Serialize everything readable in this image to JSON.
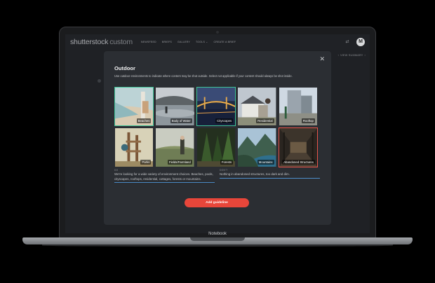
{
  "app": {
    "logo": "shutterstock",
    "logo_suffix": "custom",
    "nav": [
      "NEWSFEED",
      "BRIEFS",
      "GALLERY",
      "TOOLS ⌄",
      "CREATE A BRIEF"
    ],
    "avatar_initial": "M",
    "view_summary": "VIEW SUMMARY"
  },
  "modal": {
    "title": "Outdoor",
    "description": "Use outdoor environments to indicate where content may be shot outside. Select not applicable if your content should always be shot inside.",
    "close_symbol": "✕",
    "tiles": [
      {
        "label": "Beaches",
        "state": "selected-do"
      },
      {
        "label": "Body of Water",
        "state": "none"
      },
      {
        "label": "Cityscapes",
        "state": "selected-do"
      },
      {
        "label": "Residential",
        "state": "none"
      },
      {
        "label": "Rooftop",
        "state": "none"
      },
      {
        "label": "Parks",
        "state": "none"
      },
      {
        "label": "Fields/Farmland",
        "state": "none"
      },
      {
        "label": "Forests",
        "state": "none"
      },
      {
        "label": "Mountains",
        "state": "none"
      },
      {
        "label": "Abandoned Structures",
        "state": "selected-dont"
      }
    ],
    "do_label": "DO",
    "do_text": "We're looking for a wide variety of environment choices. Beaches, pools, cityscapes, rooftops, residential, cottages, forests or mountains.",
    "dont_label": "DON'T",
    "dont_text": "Nothing in abandoned structures, too dark and dim.",
    "add_button": "Add guideline"
  },
  "device": {
    "label": "Notebook"
  },
  "colors": {
    "do_border": "#3ec397",
    "dont_border": "#e8544a",
    "accent_button": "#e8463a",
    "modal_bg": "#2b2e33"
  }
}
